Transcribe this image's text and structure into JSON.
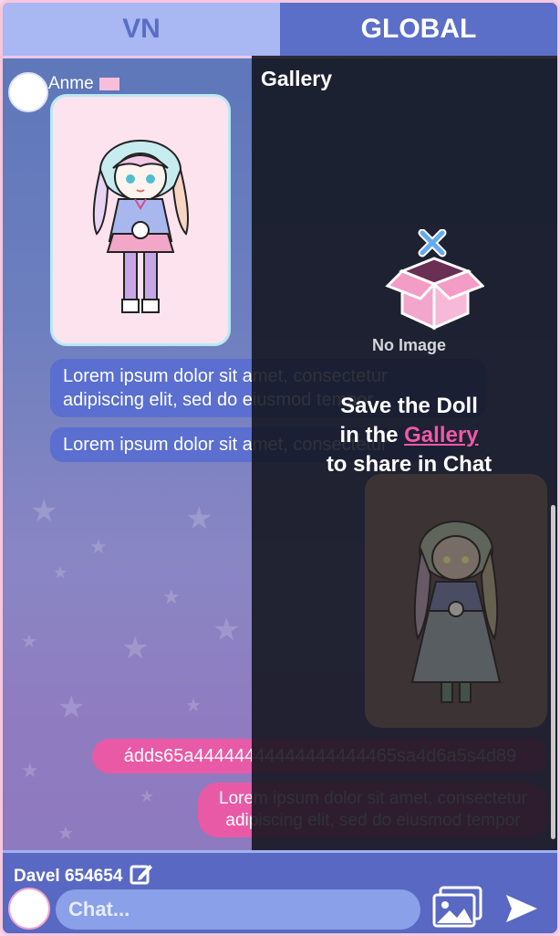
{
  "tabs": [
    {
      "label": "VN",
      "active": false
    },
    {
      "label": "GLOBAL",
      "active": true
    }
  ],
  "chat": {
    "messages": [
      {
        "user": "Anme",
        "type": "doll-image"
      },
      {
        "user": "Anme",
        "text": "Lorem ipsum dolor sit amet, consectetur adipiscing elit, sed do eiusmod tempor",
        "side": "left"
      },
      {
        "user": "Anme",
        "text": "Lorem ipsum dolor sit amet, consectetur",
        "side": "left"
      },
      {
        "user": "me",
        "type": "doll-image",
        "side": "right"
      },
      {
        "user": "me",
        "text": "ádds65a44444444444444444465sa4d6a5s4d89",
        "side": "right"
      },
      {
        "user": "me",
        "text": "Lorem ipsum dolor sit amet, consectetur adipiscing elit, sed do eiusmod tempor",
        "side": "right"
      }
    ]
  },
  "gallery": {
    "title": "Gallery",
    "empty_label": "No Image",
    "save_line1": "Save the Doll",
    "save_line2_pre": "in the ",
    "save_line2_link": "Gallery",
    "save_line3": "to share in Chat"
  },
  "bottom": {
    "username": "Davel 654654",
    "chat_placeholder": "Chat..."
  },
  "colors": {
    "accent": "#5b6fc8",
    "pink": "#e85aa6",
    "tab_inactive": "#a9b7f2"
  },
  "icons": [
    "edit-icon",
    "gallery-icon",
    "send-icon",
    "empty-box-icon",
    "close-x-icon",
    "flag-icon"
  ]
}
